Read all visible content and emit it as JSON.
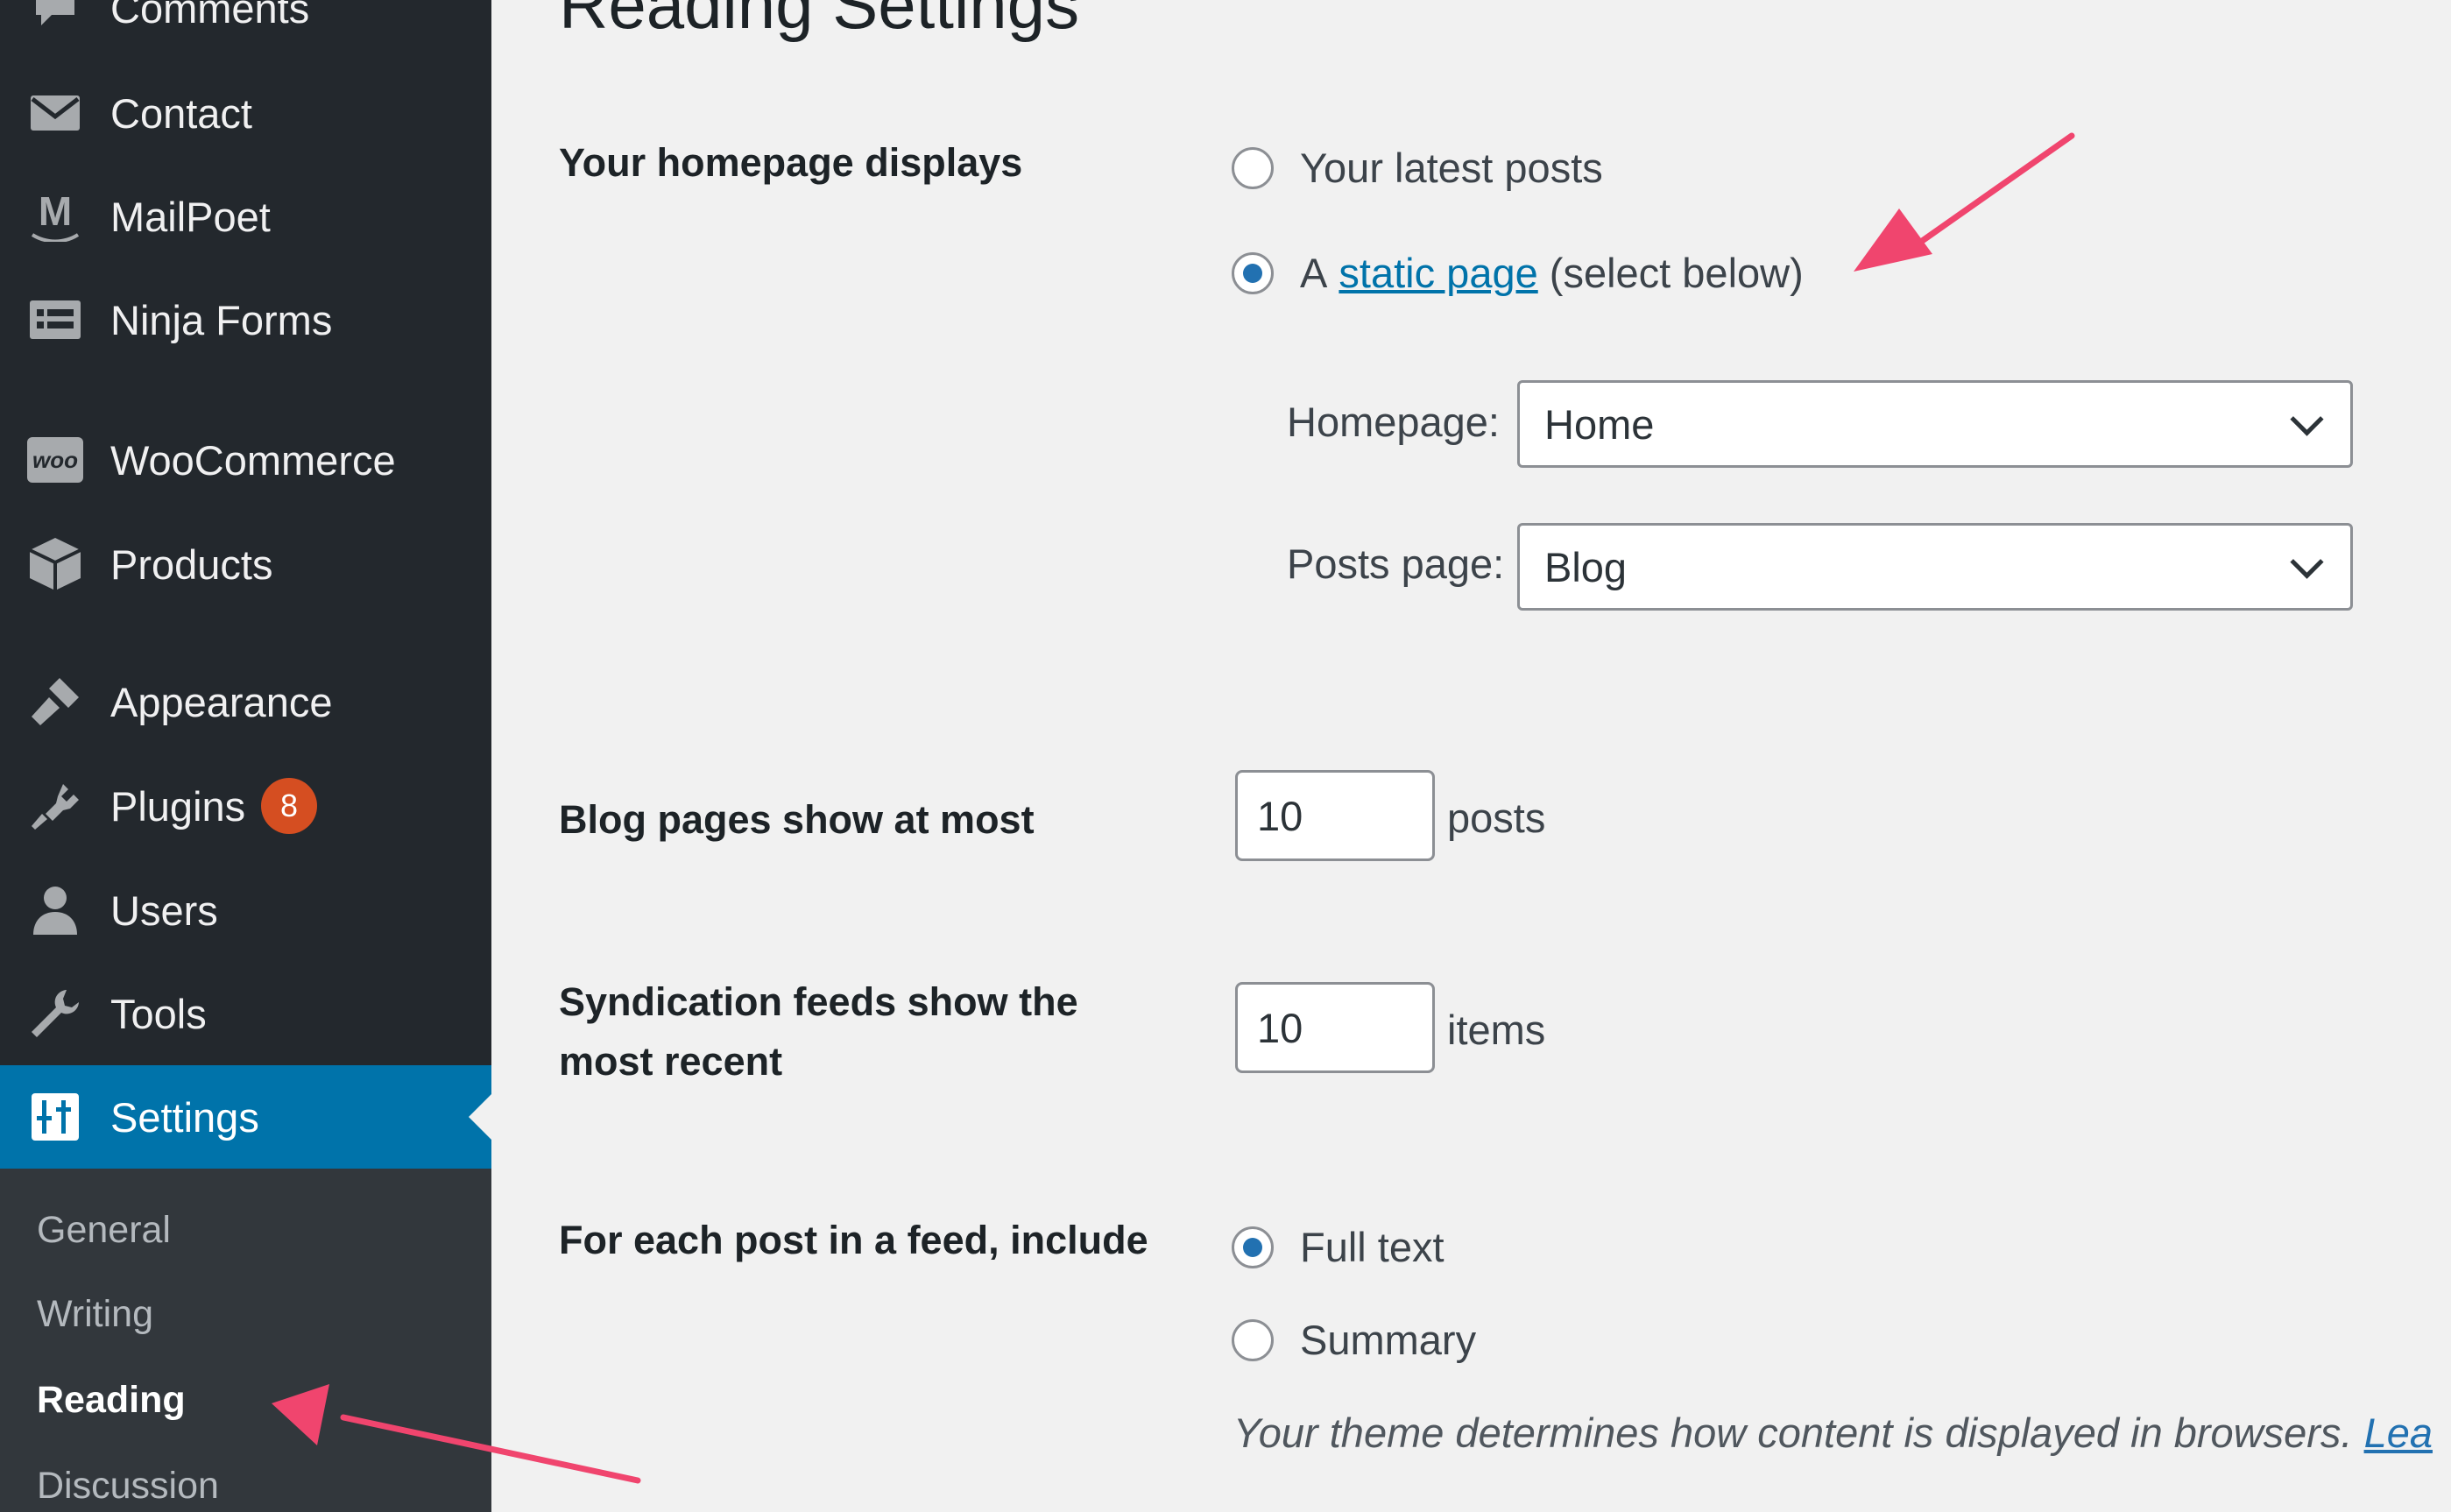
{
  "sidebar": {
    "items": [
      {
        "label": "Comments",
        "icon": "comment-icon"
      },
      {
        "label": "Contact",
        "icon": "envelope-icon"
      },
      {
        "label": "MailPoet",
        "icon": "mailpoet-icon"
      },
      {
        "label": "Ninja Forms",
        "icon": "forms-icon"
      },
      {
        "label": "WooCommerce",
        "icon": "woo-icon"
      },
      {
        "label": "Products",
        "icon": "box-icon"
      },
      {
        "label": "Appearance",
        "icon": "brush-icon"
      },
      {
        "label": "Plugins",
        "icon": "plugin-icon",
        "badge": "8"
      },
      {
        "label": "Users",
        "icon": "user-icon"
      },
      {
        "label": "Tools",
        "icon": "wrench-icon"
      },
      {
        "label": "Settings",
        "icon": "sliders-icon",
        "current": true
      }
    ],
    "woo_icon_text": "woo",
    "mailpoet_icon_text": "M",
    "submenu": [
      "General",
      "Writing",
      "Reading",
      "Discussion"
    ],
    "submenu_current": "Reading"
  },
  "page": {
    "title": "Reading Settings"
  },
  "homepage_displays": {
    "label": "Your homepage displays",
    "option_latest": "Your latest posts",
    "option_static_prefix": "A",
    "option_static_link": "static page",
    "option_static_suffix": "(select below)",
    "selected": "static"
  },
  "homepage_select": {
    "label": "Homepage:",
    "value": "Home"
  },
  "posts_page_select": {
    "label": "Posts page:",
    "value": "Blog"
  },
  "blog_pages": {
    "label": "Blog pages show at most",
    "value": "10",
    "unit": "posts"
  },
  "syndication": {
    "label_line1": "Syndication feeds show the",
    "label_line2": "most recent",
    "value": "10",
    "unit": "items"
  },
  "feed_include": {
    "label": "For each post in a feed, include",
    "option_full": "Full text",
    "option_summary": "Summary",
    "selected": "full",
    "description": "Your theme determines how content is displayed in browsers.",
    "description_link": "Lea"
  },
  "colors": {
    "sidebar_bg": "#23282d",
    "submenu_bg": "#32373c",
    "accent": "#0073aa",
    "badge": "#d54e21",
    "annotation_arrow": "#f0456e"
  }
}
